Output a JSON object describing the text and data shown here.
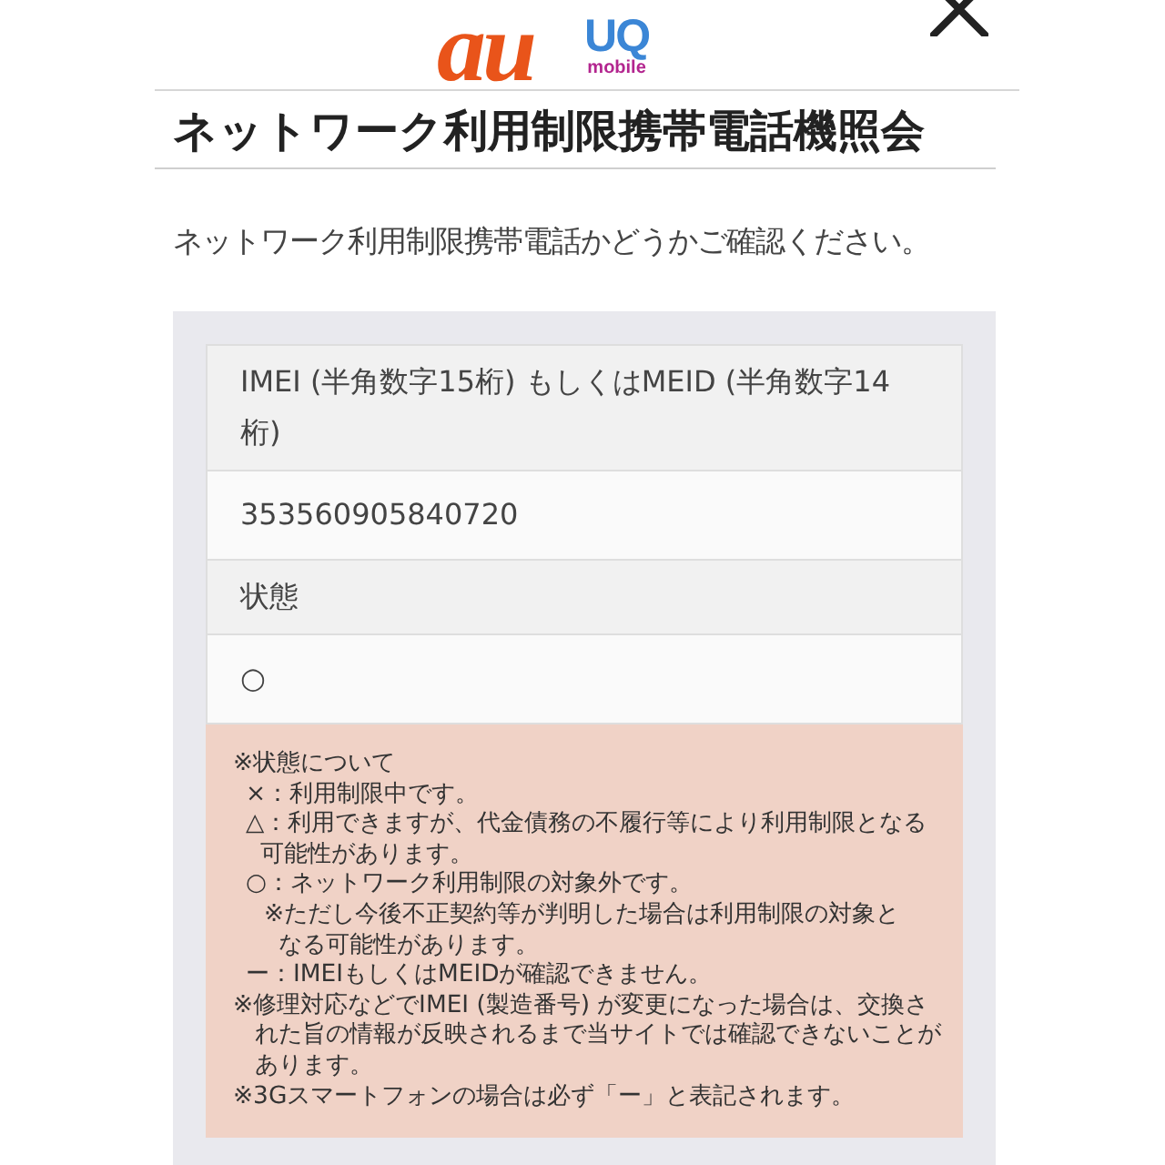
{
  "header": {
    "logos": [
      {
        "kind": "au",
        "text": "au"
      },
      {
        "kind": "uq",
        "text": "UQ",
        "subtext": "mobile"
      }
    ]
  },
  "title": "ネットワーク利用制限携帯電話機照会",
  "intro": "ネットワーク利用制限携帯電話かどうかご確認ください。",
  "result_table": {
    "rows": [
      {
        "kind": "label",
        "text": "IMEI (半角数字15桁) もしくはMEID (半角数字14桁)"
      },
      {
        "kind": "value",
        "text": "353560905840720"
      },
      {
        "kind": "label",
        "text": "状態"
      },
      {
        "kind": "value",
        "text": "○"
      }
    ]
  },
  "notes": {
    "heading": "※状態について",
    "legend": [
      {
        "text": "×：利用制限中です。"
      },
      {
        "text": "△：利用できますが、代金債務の不履行等により利用制限となる可能性があります。"
      },
      {
        "text": "○：ネットワーク利用制限の対象外です。",
        "children": [
          {
            "text": "※ただし今後不正契約等が判明した場合は利用制限の対象となる可能性があります。"
          }
        ]
      },
      {
        "text": "ー：IMEIもしくはMEIDが確認できません。"
      }
    ],
    "footnotes": [
      "※修理対応などでIMEI (製造番号) が変更になった場合は、交換された旨の情報が反映されるまで当サイトでは確認できないことがあります。",
      "※3Gスマートフォンの場合は必ず「ー」と表記されます。"
    ]
  }
}
